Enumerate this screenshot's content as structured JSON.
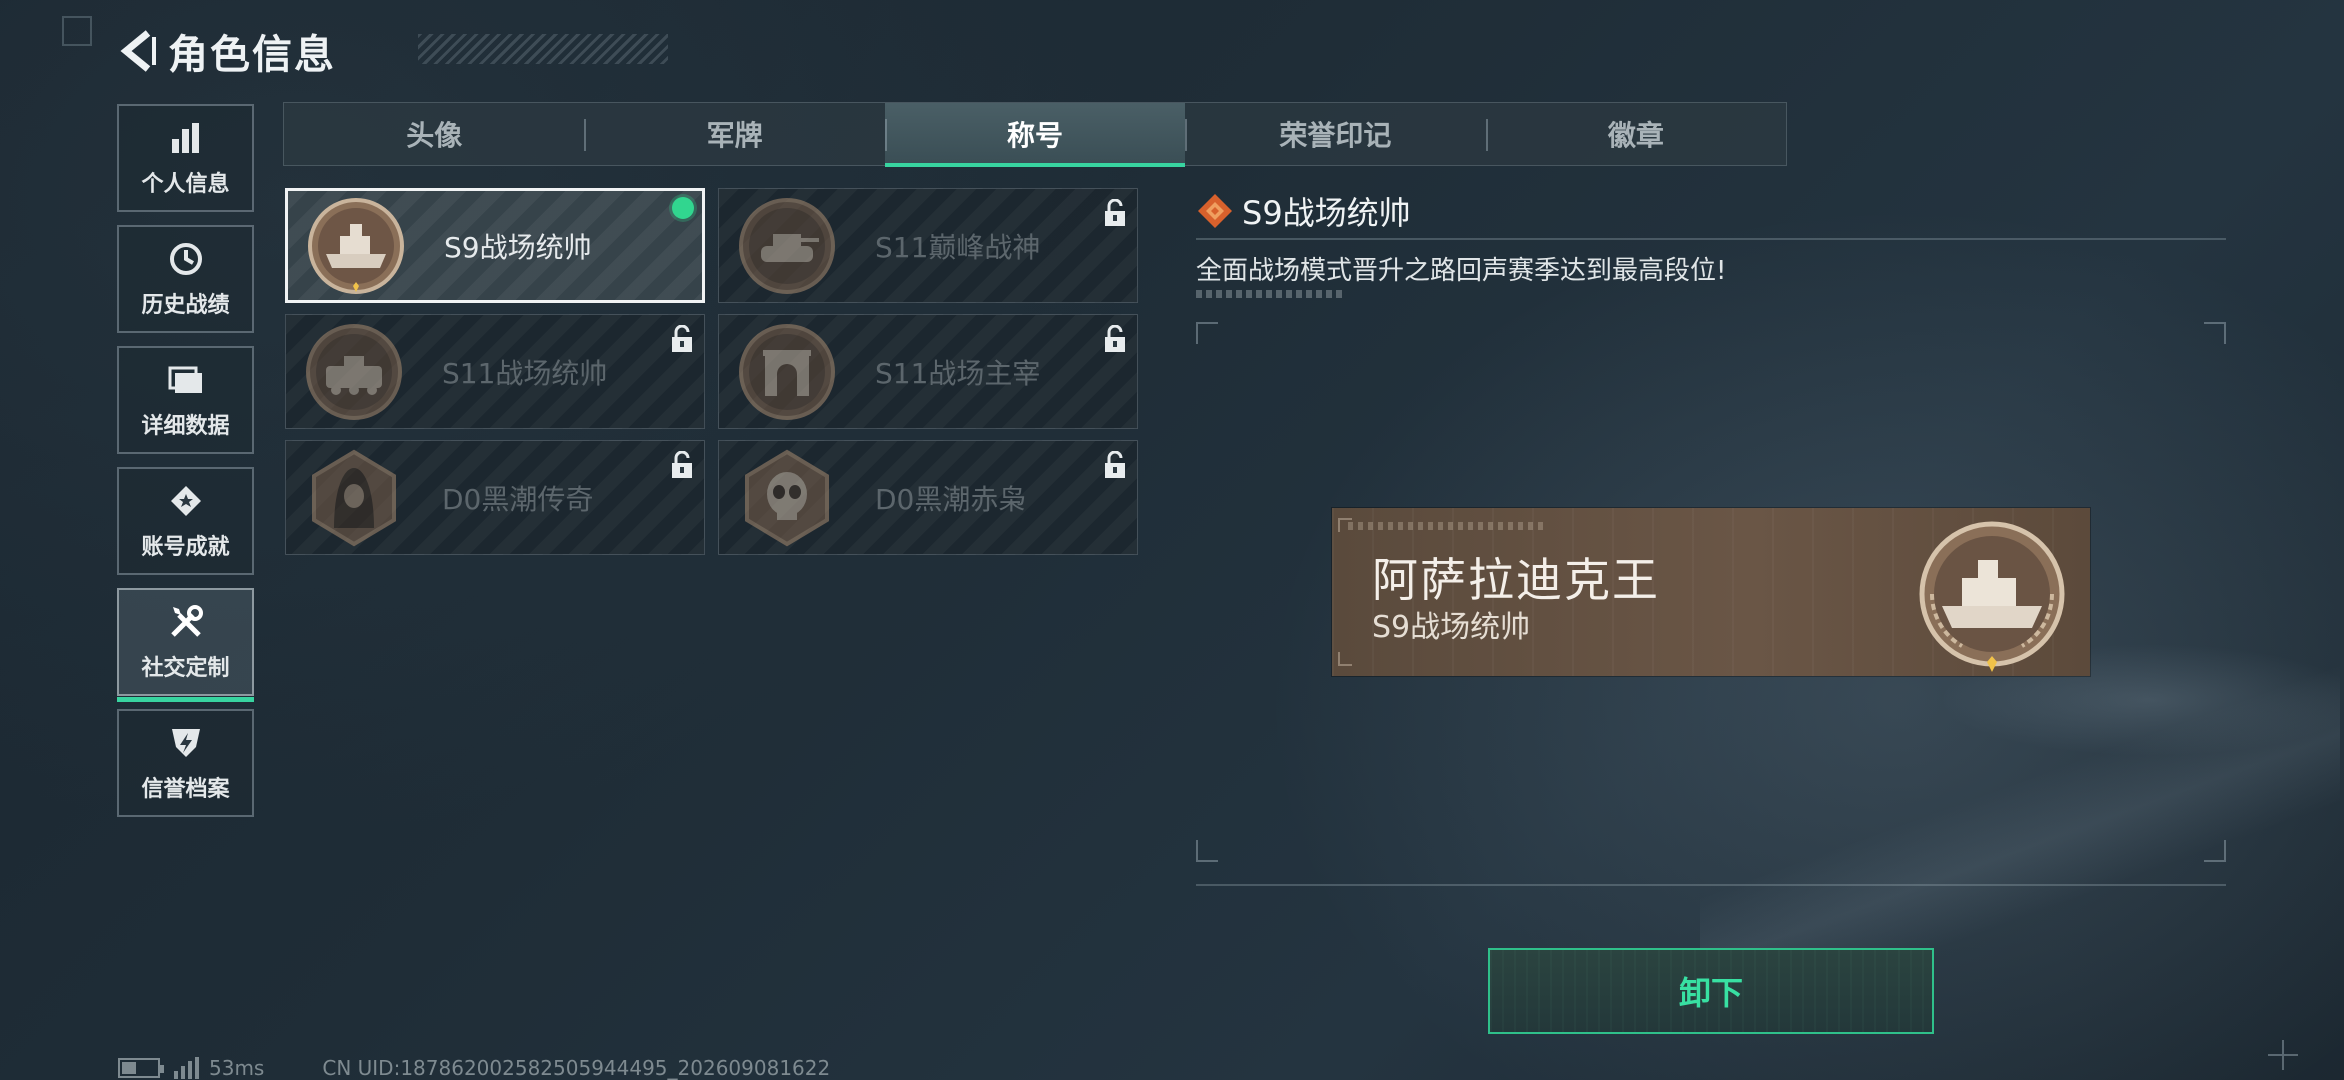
{
  "header": {
    "title": "角色信息"
  },
  "sidebar": {
    "items": [
      {
        "label": "个人信息",
        "icon": "bar-chart-icon"
      },
      {
        "label": "历史战绩",
        "icon": "clock-icon"
      },
      {
        "label": "详细数据",
        "icon": "folder-icon"
      },
      {
        "label": "账号成就",
        "icon": "achievement-icon"
      },
      {
        "label": "社交定制",
        "icon": "tools-icon",
        "active": true
      },
      {
        "label": "信誉档案",
        "icon": "credit-shield-icon"
      }
    ]
  },
  "tabs": [
    {
      "label": "头像"
    },
    {
      "label": "军牌"
    },
    {
      "label": "称号",
      "active": true
    },
    {
      "label": "荣誉印记"
    },
    {
      "label": "徽章"
    }
  ],
  "titles": [
    {
      "name": "S9战场统帅",
      "medal": "ship-medal",
      "selected": true,
      "equipped": true,
      "locked": false
    },
    {
      "name": "S11巅峰战神",
      "medal": "tank-medal",
      "locked": true
    },
    {
      "name": "S11战场统帅",
      "medal": "apc-medal",
      "locked": true
    },
    {
      "name": "S11战场主宰",
      "medal": "arch-medal",
      "locked": true
    },
    {
      "name": "D0黑潮传奇",
      "medal": "hooded-figure-medal",
      "locked": true
    },
    {
      "name": "D0黑潮赤枭",
      "medal": "skull-medal",
      "locked": true
    }
  ],
  "detail": {
    "title": "S9战场统帅",
    "description": "全面战场模式晋升之路回声赛季达到最高段位!"
  },
  "nameplate": {
    "player_name": "阿萨拉迪克王",
    "title": "S9战场统帅"
  },
  "actions": {
    "unequip_label": "卸下"
  },
  "status": {
    "ping": "53ms",
    "uid": "CN UID:18786200258250594449​5_202609081622"
  },
  "colors": {
    "accent": "#38d4a0",
    "equipped": "#31d68f",
    "nameplate_bg": "#6a5646"
  }
}
